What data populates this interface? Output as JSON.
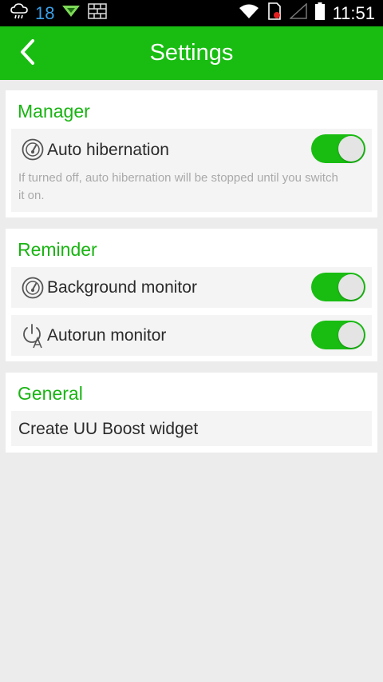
{
  "status_bar": {
    "temperature": "18",
    "time": "11:51",
    "icons": [
      "weather-cloud-icon",
      "download-icon",
      "grid-icon",
      "wifi-icon",
      "sim-icon",
      "signal-icon",
      "battery-icon"
    ]
  },
  "app_bar": {
    "title": "Settings",
    "back_icon": "chevron-left-icon"
  },
  "sections": {
    "manager": {
      "title": "Manager",
      "auto_hibernation": {
        "label": "Auto hibernation",
        "hint": "If turned off, auto hibernation will be stopped until you switch it on.",
        "enabled": true,
        "icon": "gauge-icon"
      }
    },
    "reminder": {
      "title": "Reminder",
      "background_monitor": {
        "label": "Background monitor",
        "enabled": true,
        "icon": "gauge-icon"
      },
      "autorun_monitor": {
        "label": "Autorun monitor",
        "enabled": true,
        "icon": "power-autorun-icon"
      }
    },
    "general": {
      "title": "General",
      "create_widget": {
        "label": "Create UU Boost widget"
      }
    }
  },
  "colors": {
    "accent": "#19bd12",
    "section_title": "#19b412",
    "background": "#ececec",
    "row_background": "#f4f4f4",
    "hint_text": "#a9a9a9"
  }
}
